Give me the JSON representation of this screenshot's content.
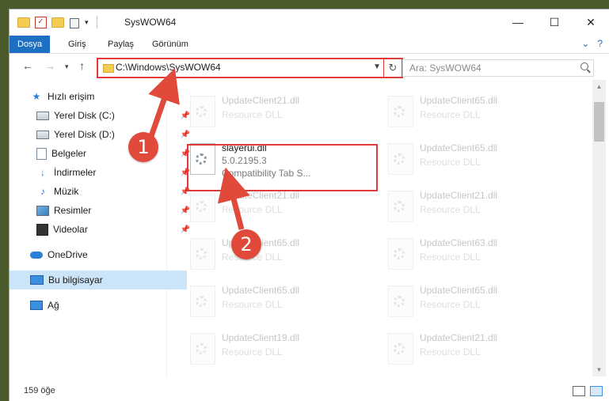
{
  "window": {
    "title": "SysWOW64",
    "controls": {
      "minimize": "—",
      "maximize": "☐",
      "close": "✕"
    }
  },
  "ribbon": {
    "tabs": [
      "Dosya",
      "Giriş",
      "Paylaş",
      "Görünüm"
    ],
    "active_tab": "Dosya"
  },
  "nav": {
    "address_path": "C:\\Windows\\SysWOW64",
    "search_placeholder": "Ara: SysWOW64"
  },
  "sidebar": {
    "items": [
      {
        "label": "Hızlı erişim",
        "icon": "star-icon"
      },
      {
        "label": "Yerel Disk (C:)",
        "icon": "drive-icon",
        "pinned": true
      },
      {
        "label": "Yerel Disk (D:)",
        "icon": "drive-icon",
        "pinned": true
      },
      {
        "label": "Belgeler",
        "icon": "documents-icon",
        "pinned": true
      },
      {
        "label": "İndirmeler",
        "icon": "downloads-icon",
        "pinned": true
      },
      {
        "label": "Müzik",
        "icon": "music-icon",
        "pinned": true
      },
      {
        "label": "Resimler",
        "icon": "pictures-icon",
        "pinned": true
      },
      {
        "label": "Videolar",
        "icon": "videos-icon",
        "pinned": true
      },
      {
        "label": "OneDrive",
        "icon": "onedrive-icon"
      },
      {
        "label": "Bu bilgisayar",
        "icon": "computer-icon",
        "selected": true
      },
      {
        "label": "Ağ",
        "icon": "network-icon"
      }
    ]
  },
  "files": {
    "highlighted": {
      "name": "slayerui.dll",
      "version": "5.0.2195.3",
      "description": "Compatibility Tab S..."
    },
    "left_column": [
      {
        "name": "UpdateClient21.dll",
        "type": "Resource DLL"
      },
      {
        "name": "UpdateClient21.dll",
        "type": "Resource DLL"
      },
      {
        "name": "UpdateClient65.dll",
        "type": "Resource DLL"
      },
      {
        "name": "UpdateClient65.dll",
        "type": "Resource DLL"
      },
      {
        "name": "UpdateClient19.dll",
        "type": "Resource DLL"
      }
    ],
    "right_column": [
      {
        "name": "UpdateClient65.dll",
        "type": "Resource DLL"
      },
      {
        "name": "UpdateClient65.dll",
        "type": "Resource DLL"
      },
      {
        "name": "UpdateClient21.dll",
        "type": "Resource DLL"
      },
      {
        "name": "UpdateClient63.dll",
        "type": "Resource DLL"
      },
      {
        "name": "UpdateClient65.dll",
        "type": "Resource DLL"
      },
      {
        "name": "UpdateClient21.dll",
        "type": "Resource DLL"
      }
    ]
  },
  "status": {
    "item_count": "159 öğe"
  },
  "callouts": [
    "1",
    "2"
  ],
  "colors": {
    "accent": "#1e6fc2",
    "callout": "#e14a3a",
    "highlight_border": "#e03b3b",
    "selected": "#cce4f7"
  }
}
